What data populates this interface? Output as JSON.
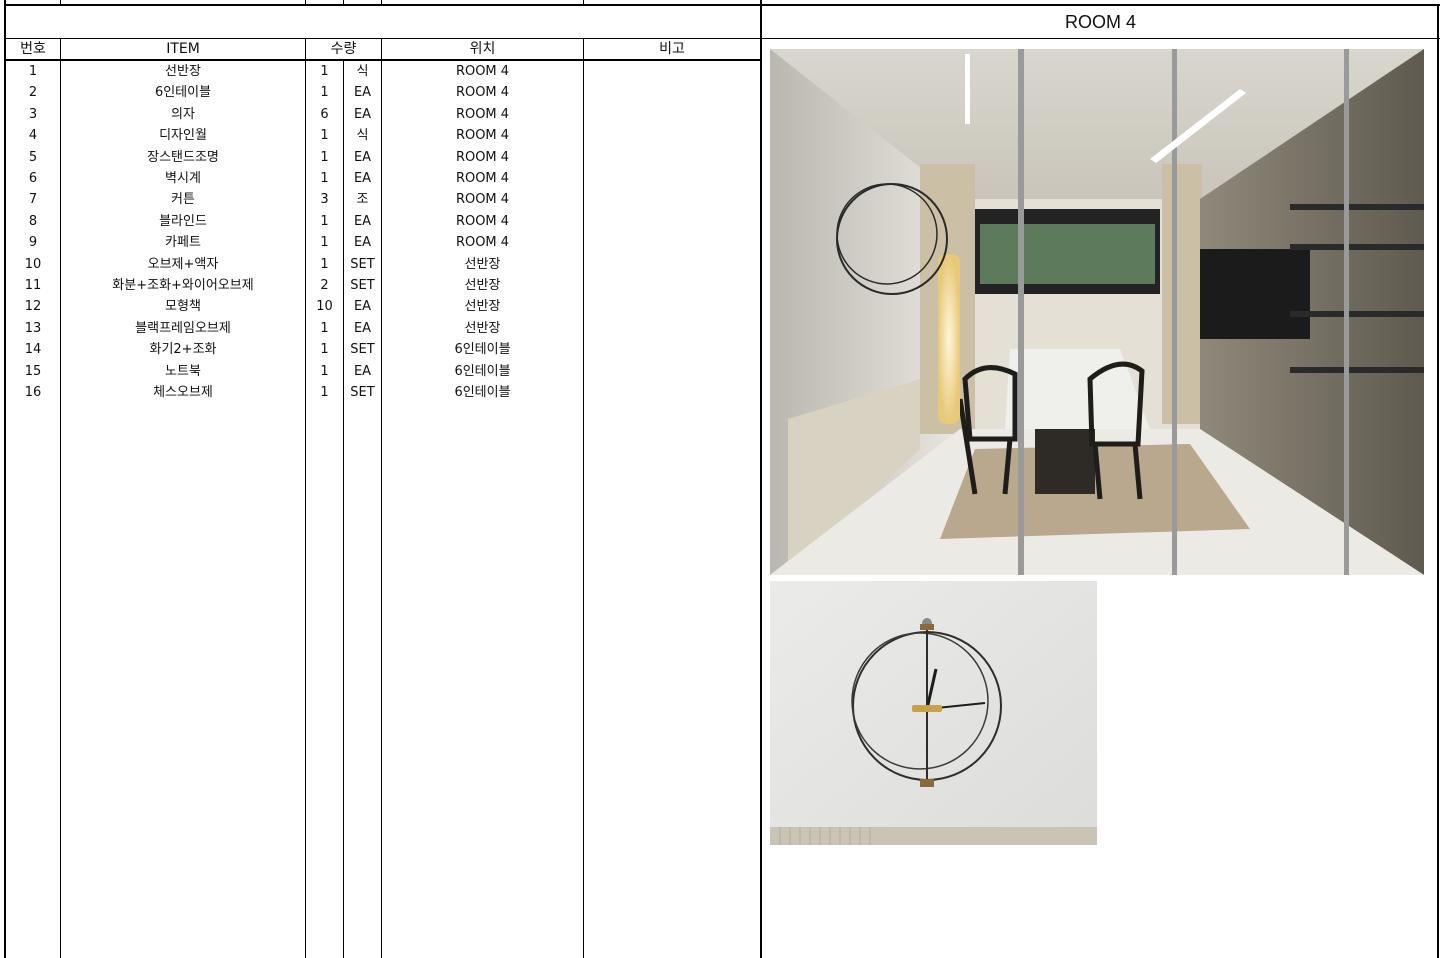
{
  "header": {
    "room_title": "ROOM 4",
    "columns": {
      "no": "번호",
      "item": "ITEM",
      "qty": "수량",
      "location": "위치",
      "note": "비고"
    }
  },
  "rows": [
    {
      "no": "1",
      "item": "선반장",
      "qty": "1",
      "unit": "식",
      "location": "ROOM 4"
    },
    {
      "no": "2",
      "item": "6인테이블",
      "qty": "1",
      "unit": "EA",
      "location": "ROOM 4"
    },
    {
      "no": "3",
      "item": "의자",
      "qty": "6",
      "unit": "EA",
      "location": "ROOM 4"
    },
    {
      "no": "4",
      "item": "디자인월",
      "qty": "1",
      "unit": "식",
      "location": "ROOM 4"
    },
    {
      "no": "5",
      "item": "장스탠드조명",
      "qty": "1",
      "unit": "EA",
      "location": "ROOM 4"
    },
    {
      "no": "6",
      "item": "벽시계",
      "qty": "1",
      "unit": "EA",
      "location": "ROOM 4"
    },
    {
      "no": "7",
      "item": "커튼",
      "qty": "3",
      "unit": "조",
      "location": "ROOM 4"
    },
    {
      "no": "8",
      "item": "블라인드",
      "qty": "1",
      "unit": "EA",
      "location": "ROOM 4"
    },
    {
      "no": "9",
      "item": "카페트",
      "qty": "1",
      "unit": "EA",
      "location": "ROOM 4"
    },
    {
      "no": "10",
      "item": "오브제+액자",
      "qty": "1",
      "unit": "SET",
      "location": "선반장"
    },
    {
      "no": "11",
      "item": "화분+조화+와이어오브제",
      "qty": "2",
      "unit": "SET",
      "location": "선반장"
    },
    {
      "no": "12",
      "item": "모형책",
      "qty": "10",
      "unit": "EA",
      "location": "선반장"
    },
    {
      "no": "13",
      "item": "블랙프레임오브제",
      "qty": "1",
      "unit": "EA",
      "location": "선반장"
    },
    {
      "no": "14",
      "item": "화기2+조화",
      "qty": "1",
      "unit": "SET",
      "location": "6인테이블"
    },
    {
      "no": "15",
      "item": "노트북",
      "qty": "1",
      "unit": "EA",
      "location": "6인테이블"
    },
    {
      "no": "16",
      "item": "체스오브제",
      "qty": "1",
      "unit": "SET",
      "location": "6인테이블"
    }
  ]
}
